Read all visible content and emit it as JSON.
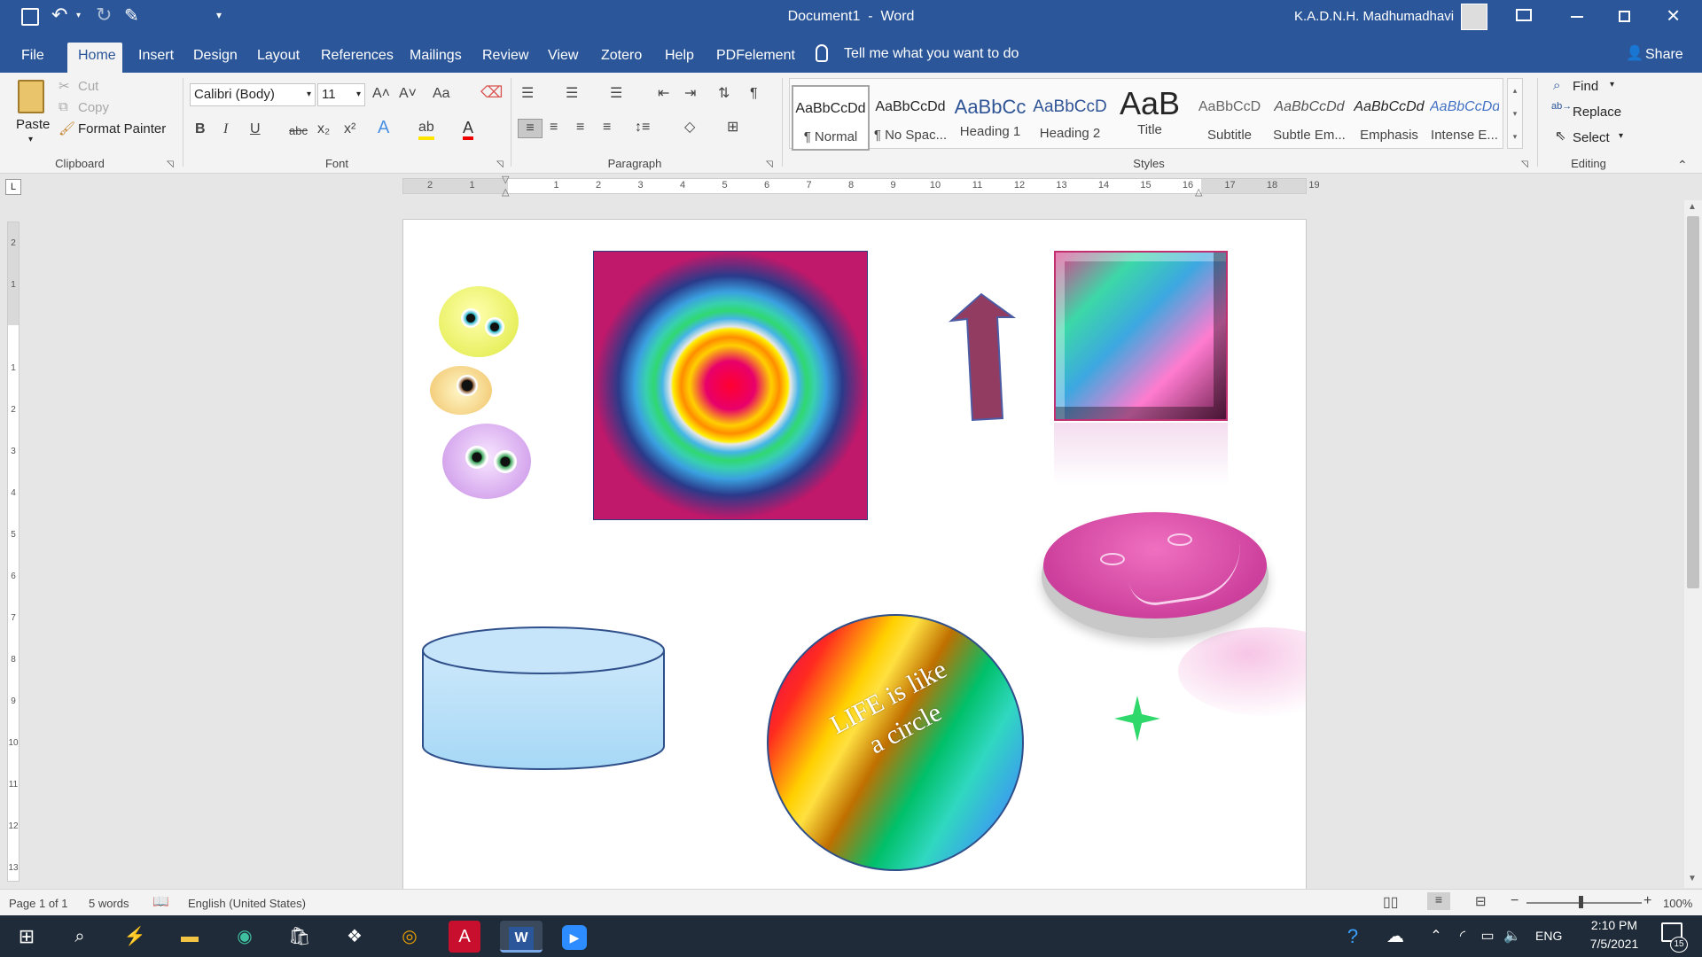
{
  "window": {
    "title": "Document1  -  Word",
    "user": "K.A.D.N.H. Madhumadhavi"
  },
  "qat": {
    "save": "save-icon",
    "undo": "undo-icon",
    "redo": "redo-icon"
  },
  "menu": {
    "file": "File",
    "home": "Home",
    "insert": "Insert",
    "design": "Design",
    "layout": "Layout",
    "references": "References",
    "mailings": "Mailings",
    "review": "Review",
    "view": "View",
    "zotero": "Zotero",
    "help": "Help",
    "pdfelement": "PDFelement",
    "tell_me": "Tell me what you want to do",
    "share": "Share"
  },
  "clipboard": {
    "paste": "Paste",
    "cut": "Cut",
    "copy": "Copy",
    "format_painter": "Format Painter",
    "label": "Clipboard"
  },
  "font": {
    "name": "Calibri (Body)",
    "size": "11",
    "label": "Font",
    "bold": "B",
    "italic": "I",
    "underline": "U",
    "strike": "abc",
    "subscript": "x₂",
    "superscript": "x²",
    "grow": "A˄",
    "shrink": "A˅",
    "case": "Aa",
    "text_effects": "A",
    "highlight": "ab",
    "font_color": "A"
  },
  "paragraph": {
    "label": "Paragraph"
  },
  "styles": {
    "label": "Styles",
    "items": [
      {
        "preview": "AaBbCcDd",
        "name": "¶ Normal"
      },
      {
        "preview": "AaBbCcDd",
        "name": "¶ No Spac..."
      },
      {
        "preview": "AaBbCc",
        "name": "Heading 1"
      },
      {
        "preview": "AaBbCcD",
        "name": "Heading 2"
      },
      {
        "preview": "AaB",
        "name": "Title"
      },
      {
        "preview": "AaBbCcD",
        "name": "Subtitle"
      },
      {
        "preview": "AaBbCcDd",
        "name": "Subtle Em..."
      },
      {
        "preview": "AaBbCcDd",
        "name": "Emphasis"
      },
      {
        "preview": "AaBbCcDd",
        "name": "Intense E..."
      }
    ]
  },
  "editing": {
    "find": "Find",
    "replace": "Replace",
    "select": "Select",
    "label": "Editing"
  },
  "ruler": {
    "h_ticks": [
      "2",
      "1",
      "",
      "1",
      "2",
      "3",
      "4",
      "5",
      "6",
      "7",
      "8",
      "9",
      "10",
      "11",
      "12",
      "13",
      "14",
      "15",
      "16",
      "17",
      "18",
      "19"
    ],
    "v_ticks": [
      "2",
      "1",
      "",
      "1",
      "2",
      "3",
      "4",
      "5",
      "6",
      "7",
      "8",
      "9",
      "10",
      "11",
      "12",
      "13"
    ]
  },
  "document": {
    "circle_text_line1": "LIFE is like",
    "circle_text_line2": "a circle"
  },
  "status": {
    "page": "Page 1 of 1",
    "words": "5 words",
    "language": "English (United States)",
    "zoom": "100%"
  },
  "taskbar": {
    "time": "2:10 PM",
    "date": "7/5/2021",
    "lang": "ENG",
    "notifications": "15"
  }
}
